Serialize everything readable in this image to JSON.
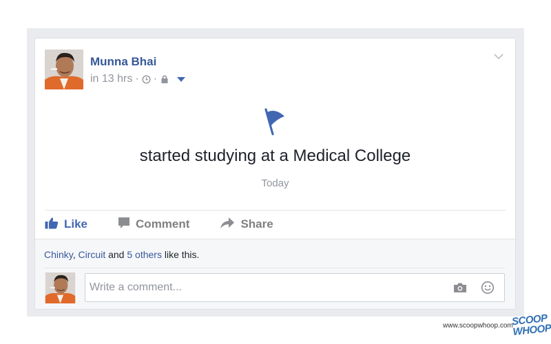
{
  "post": {
    "author": "Munna Bhai",
    "time": "in 13 hrs",
    "separator": "·",
    "meta_icons": [
      "clock-icon",
      "lock-icon",
      "audience-caret-icon"
    ],
    "menu_icon": "chevron-down-icon",
    "event_icon": "flag-icon",
    "event_text": "started studying at a Medical College",
    "event_date": "Today"
  },
  "actions": {
    "like": "Like",
    "comment": "Comment",
    "share": "Share"
  },
  "likes": {
    "name1": "Chinky",
    "comma": ",",
    "name2": "Circuit",
    "and": "and",
    "others": "5 others",
    "suffix": "like this."
  },
  "comment_box": {
    "placeholder": "Write a comment...",
    "icons": [
      "camera-icon",
      "smiley-icon"
    ]
  },
  "watermark": {
    "source": "www.scoopwhoop.com",
    "brand_line1": "SCOOP",
    "brand_line2": "WHOOP"
  },
  "colors": {
    "link": "#365899",
    "like_blue": "#4267b2",
    "muted": "#90949c",
    "flag": "#4267b2",
    "backdrop": "#e9ebee",
    "brand": "#2f6fb4"
  }
}
